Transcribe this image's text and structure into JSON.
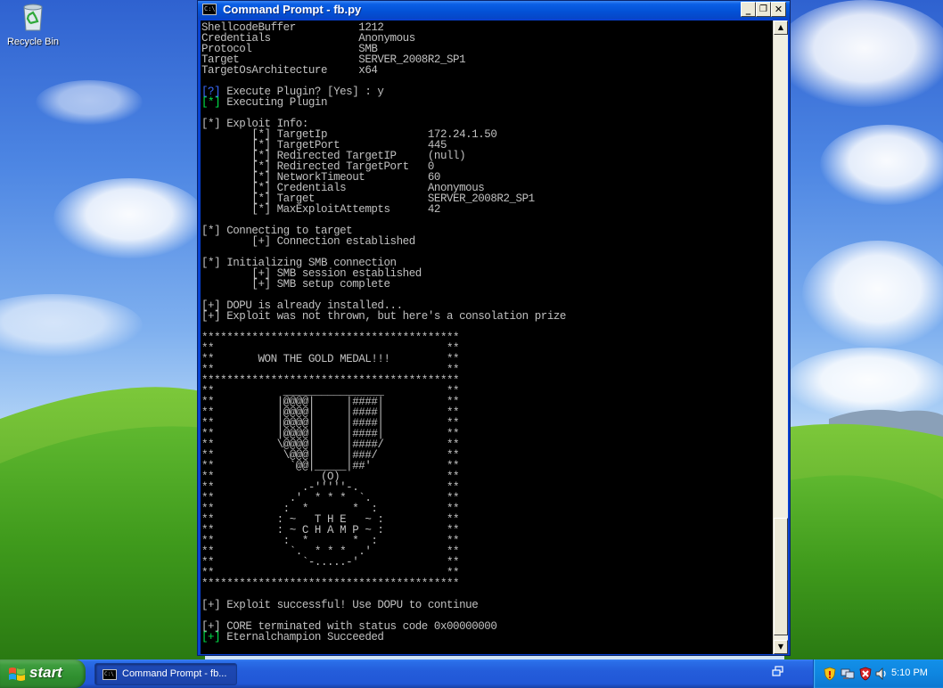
{
  "desktop": {
    "icons": [
      {
        "label": "Recycle Bin",
        "icon": "recycle-bin-icon"
      }
    ]
  },
  "window": {
    "title": "Command Prompt - fb.py",
    "icon": "console-icon",
    "buttons": {
      "minimize": "_",
      "restore": "❐",
      "close": "✕"
    },
    "console_lines": [
      "ShellcodeBuffer          1212",
      "Credentials              Anonymous",
      "Protocol                 SMB",
      "Target                   SERVER_2008R2_SP1",
      "TargetOsArchitecture     x64",
      "",
      "[?] Execute Plugin? [Yes] : y",
      "[*] Executing Plugin",
      "",
      "[*] Exploit Info:",
      "        [*] TargetIp                172.24.1.50",
      "        [*] TargetPort              445",
      "        [*] Redirected TargetIP     (null)",
      "        [*] Redirected TargetPort   0",
      "        [*] NetworkTimeout          60",
      "        [*] Credentials             Anonymous",
      "        [*] Target                  SERVER_2008R2_SP1",
      "        [*] MaxExploitAttempts      42",
      "",
      "[*] Connecting to target",
      "        [+] Connection established",
      "",
      "[*] Initializing SMB connection",
      "        [+] SMB session established",
      "        [+] SMB setup complete",
      "",
      "[+] DOPU is already installed...",
      "[+] Exploit was not thrown, but here's a consolation prize",
      "",
      "*****************************************",
      "**                                     **",
      "**       WON THE GOLD MEDAL!!!         **",
      "**                                     **",
      "*****************************************",
      "**           ________________          **",
      "**          |@@@@|     |####|          **",
      "**          |@@@@|     |####|          **",
      "**          |@@@@|     |####|          **",
      "**          |@@@@|     |####|          **",
      "**          \\@@@@|     |####/          **",
      "**           \\@@@|     |###/           **",
      "**            `@@|_____|##'            **",
      "**                 (O)                 **",
      "**              .-'''''-.              **",
      "**            .'  * * *  `.            **",
      "**           :  *       *  :           **",
      "**          : ~   T H E   ~ :          **",
      "**          : ~ C H A M P ~ :          **",
      "**           :  *       *  :           **",
      "**            `.  * * *  .'            **",
      "**              `-.....-'              **",
      "**                                     **",
      "*****************************************",
      "",
      "[+] Exploit successful! Use DOPU to continue",
      "",
      "[+] CORE terminated with status code 0x00000000",
      "[+] Eternalchampion Succeeded"
    ],
    "scrollbar": {
      "up": "▲",
      "down": "▼"
    }
  },
  "taskbar": {
    "start_label": "start",
    "task_label": "Command Prompt - fb...",
    "clock": "5:10 PM",
    "tray_icons": [
      "security-shield-icon",
      "network-icon",
      "security-alert-icon",
      "volume-icon"
    ]
  }
}
